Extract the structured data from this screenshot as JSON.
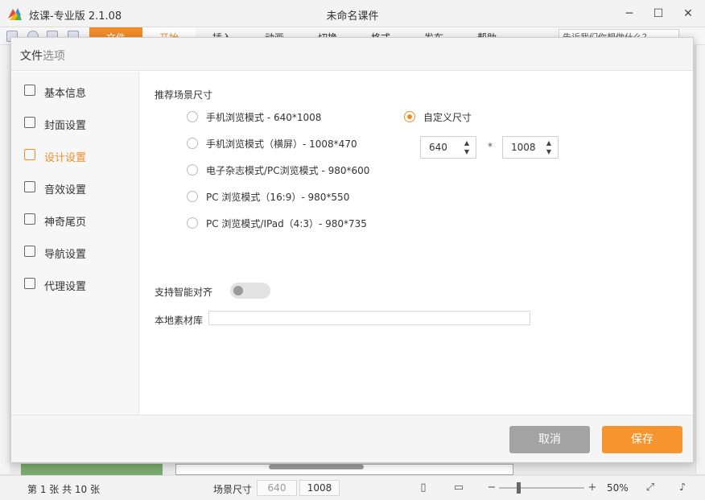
{
  "app": {
    "title": "炫课-专业版 2.1.08",
    "document_title": "未命名课件",
    "window_controls": [
      "─",
      "☐",
      "✕"
    ]
  },
  "ribbon": {
    "tabs": [
      "文件",
      "开始",
      "插入",
      "动画",
      "切换",
      "格式",
      "发布",
      "帮助"
    ],
    "search_text": "告诉我们你想做什么？"
  },
  "dialog": {
    "title_main": "文件",
    "title_sub": "选项",
    "nav": [
      {
        "label": "基本信息",
        "icon": "list-icon"
      },
      {
        "label": "封面设置",
        "icon": "image-icon"
      },
      {
        "label": "设计设置",
        "icon": "edit-icon",
        "active": true
      },
      {
        "label": "音效设置",
        "icon": "music-icon"
      },
      {
        "label": "神奇尾页",
        "icon": "grid-icon"
      },
      {
        "label": "导航设置",
        "icon": "nav-icon"
      },
      {
        "label": "代理设置",
        "icon": "user-icon"
      }
    ],
    "scene_size_label": "推荐场景尺寸",
    "scene_options": [
      {
        "label": "手机浏览模式 - 640*1008",
        "checked": false
      },
      {
        "label": "手机浏览模式（横屏）- 1008*470",
        "checked": false
      },
      {
        "label": "电子杂志模式/PC浏览模式 - 980*600",
        "checked": false
      },
      {
        "label": "PC 浏览模式（16:9）- 980*550",
        "checked": false
      },
      {
        "label": "PC 浏览模式/IPad（4:3）- 980*735",
        "checked": false
      }
    ],
    "custom_option": {
      "label": "自定义尺寸",
      "checked": true
    },
    "custom_width": "640",
    "custom_height": "1008",
    "times_symbol": "*",
    "smart_align_label": "支持智能对齐",
    "smart_align_on": false,
    "local_library_label": "本地素材库",
    "local_library_value": "",
    "cancel_label": "取消",
    "save_label": "保存"
  },
  "statusbar": {
    "page_info": "第 1 张   共 10 张",
    "scene_size_label": "场景尺寸",
    "scene_width": "640",
    "scene_height": "1008",
    "zoom_minus": "−",
    "zoom_plus": "+",
    "zoom_level": "50%",
    "zoom_fraction": 0.2
  },
  "colors": {
    "accent": "#f08c28",
    "save_button": "#f6952d",
    "cancel_button": "#a3a3a3"
  }
}
